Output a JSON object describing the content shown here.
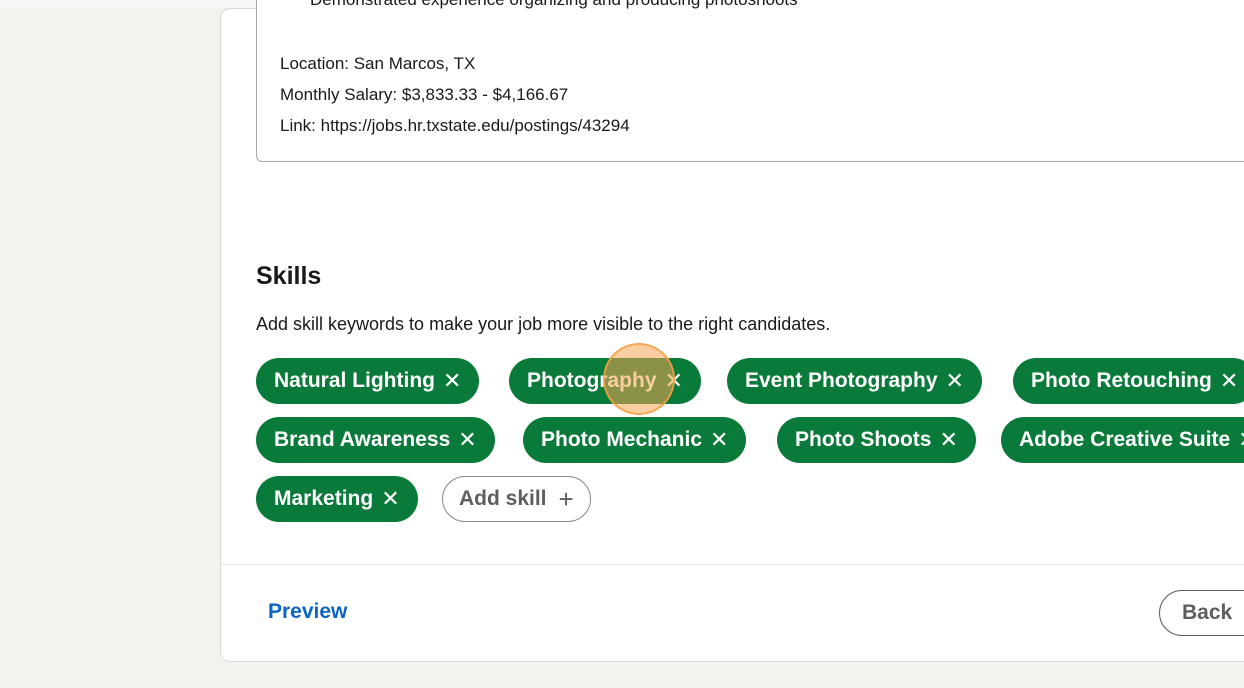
{
  "job_description": {
    "cut_line": "Demonstrated experience organizing and producing photoshoots",
    "location": "Location: San Marcos, TX",
    "salary": "Monthly Salary: $3,833.33 - $4,166.67",
    "link": "Link: https://jobs.hr.txstate.edu/postings/43294"
  },
  "skills": {
    "title": "Skills",
    "help_text": "Add skill keywords to make your job more visible to the right candidates.",
    "items": [
      {
        "label": "Natural Lighting"
      },
      {
        "label": "Photography"
      },
      {
        "label": "Event Photography"
      },
      {
        "label": "Photo Retouching"
      },
      {
        "label": "Brand Awareness"
      },
      {
        "label": "Photo Mechanic"
      },
      {
        "label": "Photo Shoots"
      },
      {
        "label": "Adobe Creative Suite"
      },
      {
        "label": "Marketing"
      }
    ],
    "remove_glyph": "✕",
    "add_label": "Add skill",
    "add_glyph": "+"
  },
  "footer": {
    "preview_label": "Preview",
    "back_label": "Back"
  },
  "colors": {
    "chip_bg": "#0a7a3b",
    "link_blue": "#0a66c2",
    "page_bg": "#f3f2ee"
  }
}
